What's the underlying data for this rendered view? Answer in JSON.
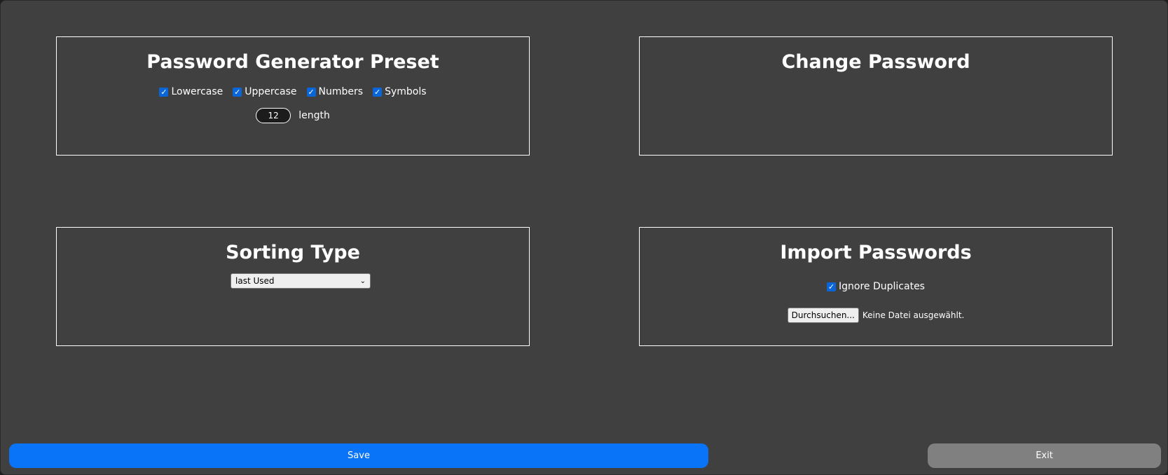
{
  "generator": {
    "title": "Password Generator Preset",
    "options": [
      {
        "label": "Lowercase",
        "checked": true
      },
      {
        "label": "Uppercase",
        "checked": true
      },
      {
        "label": "Numbers",
        "checked": true
      },
      {
        "label": "Symbols",
        "checked": true
      }
    ],
    "length_value": "12",
    "length_label": "length"
  },
  "change_password": {
    "title": "Change Password"
  },
  "sorting": {
    "title": "Sorting Type",
    "selected": "last Used"
  },
  "import": {
    "title": "Import Passwords",
    "ignore_duplicates_label": "Ignore Duplicates",
    "ignore_duplicates_checked": true,
    "browse_label": "Durchsuchen...",
    "no_file_text": "Keine Datei ausgewählt."
  },
  "footer": {
    "save_label": "Save",
    "exit_label": "Exit"
  },
  "colors": {
    "background": "#404040",
    "accent": "#0a74f8",
    "secondary": "#808080",
    "checkbox": "#0a66d8"
  },
  "icons": {
    "checkbox": "checkmark-icon",
    "dropdown": "chevron-down-icon"
  }
}
